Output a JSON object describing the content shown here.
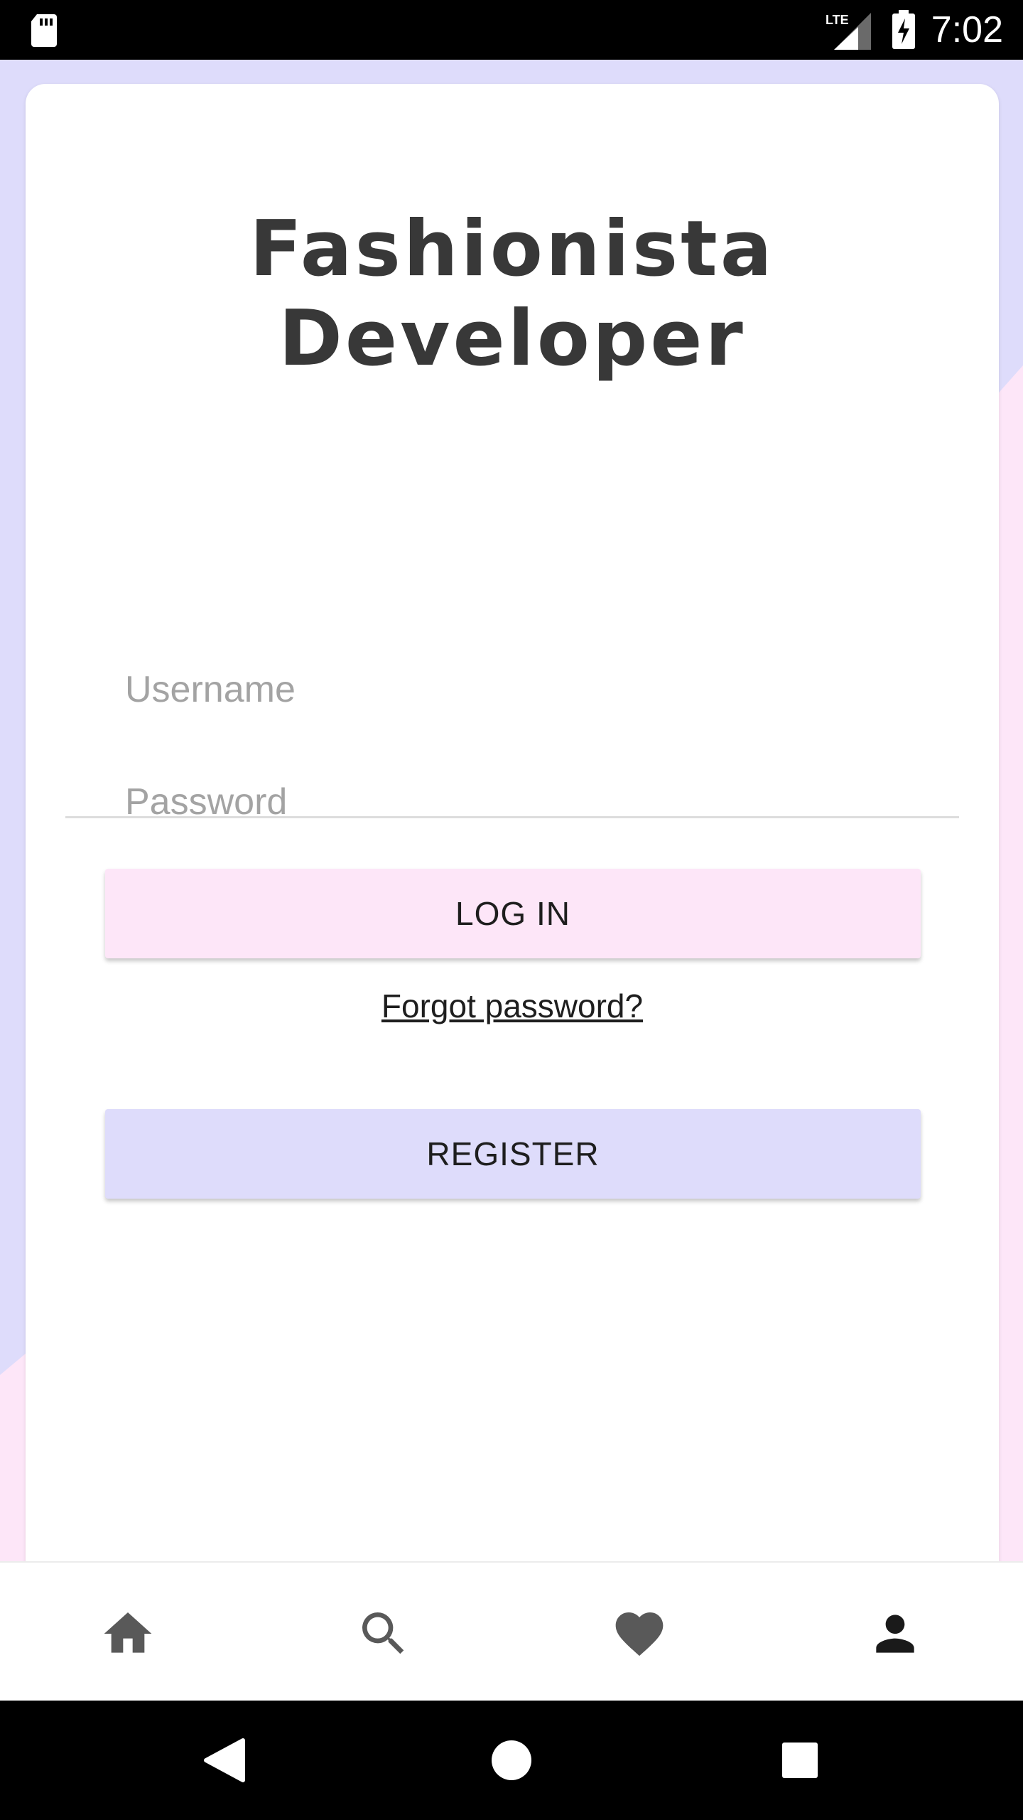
{
  "status_bar": {
    "time": "7:02",
    "icons": [
      "sd-card-icon",
      "lte-signal-icon",
      "battery-charging-icon"
    ]
  },
  "app": {
    "title_line1": "Fashionista",
    "title_line2": "Developer"
  },
  "login_form": {
    "username_placeholder": "Username",
    "username_value": "",
    "password_placeholder": "Password",
    "password_value": "",
    "login_label": "LOG IN",
    "forgot_label": "Forgot password?",
    "register_label": "REGISTER"
  },
  "bottom_nav": {
    "items": [
      {
        "icon": "home-icon",
        "active": false
      },
      {
        "icon": "search-icon",
        "active": false
      },
      {
        "icon": "heart-icon",
        "active": false
      },
      {
        "icon": "person-icon",
        "active": true
      }
    ]
  },
  "system_nav": {
    "icons": [
      "back-icon",
      "home-circle-icon",
      "recents-icon"
    ]
  },
  "colors": {
    "background_lavender": "#dedcfb",
    "background_pink": "#fde6f8",
    "card": "#ffffff",
    "title_text": "#383838",
    "login_button": "#fde6f8",
    "register_button": "#dedcfb",
    "nav_icon": "#595959",
    "nav_icon_active": "#1a1a1a"
  }
}
